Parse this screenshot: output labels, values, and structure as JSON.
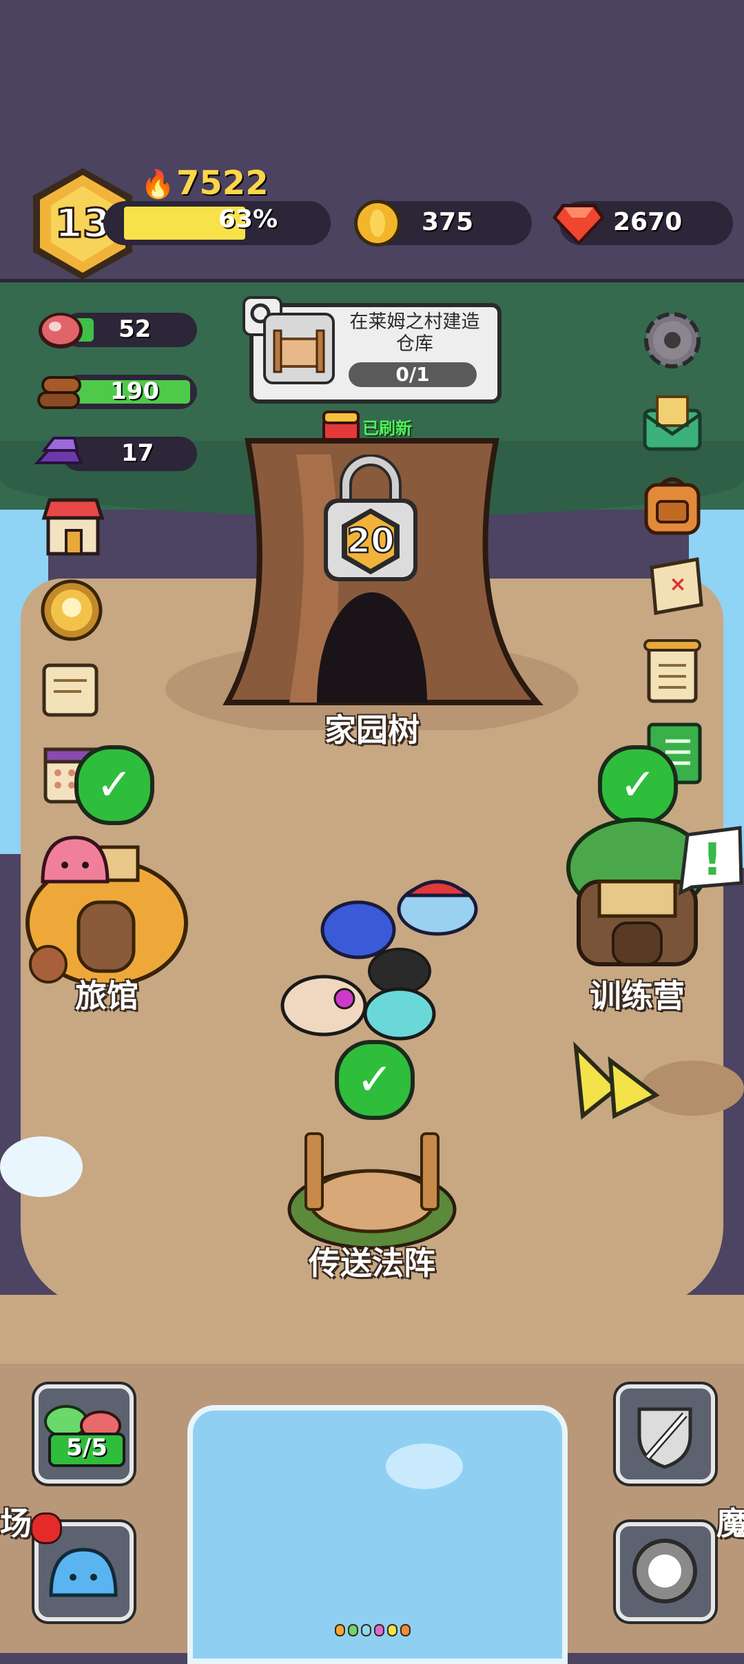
{
  "hud": {
    "level": "13",
    "power": "7522",
    "xp_percent_text": "63%",
    "xp_fraction": 0.63,
    "gold": "375",
    "gems": "2670"
  },
  "resources": {
    "meat": "52",
    "wood": "190",
    "ingot": "17"
  },
  "quest": {
    "title": "在莱姆之村建造仓库",
    "progress": "0/1"
  },
  "refresh_badge": "已刷新",
  "tree": {
    "lock_level": "20",
    "name": "家园树"
  },
  "buildings": {
    "inn": "旅馆",
    "training_camp": "训练营",
    "teleport": "传送法阵"
  },
  "bottom": {
    "slime_counter": "5/5",
    "left_edge_label": "场",
    "right_edge_label": "魔"
  },
  "colors": {
    "topbar": "#4b4360",
    "xp_bar": "#f7e24a",
    "ground": "#c7a883",
    "water": "#8fd3f5",
    "check_green": "#2fbd3c"
  }
}
